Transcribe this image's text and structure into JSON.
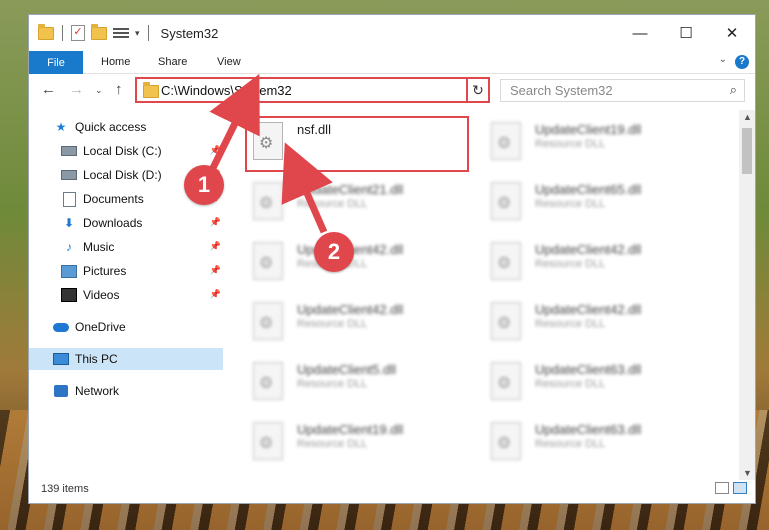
{
  "window": {
    "title": "System32",
    "controls": {
      "minimize": "—",
      "maximize": "☐",
      "close": "✕"
    }
  },
  "ribbon": {
    "file": "File",
    "tabs": [
      "Home",
      "Share",
      "View"
    ],
    "help": "?"
  },
  "address": {
    "path": "C:\\Windows\\System32",
    "search_placeholder": "Search System32"
  },
  "nav": {
    "items": [
      {
        "label": "Quick access"
      },
      {
        "label": "Local Disk (C:)"
      },
      {
        "label": "Local Disk (D:)"
      },
      {
        "label": "Documents"
      },
      {
        "label": "Downloads"
      },
      {
        "label": "Music"
      },
      {
        "label": "Pictures"
      },
      {
        "label": "Videos"
      },
      {
        "label": "OneDrive"
      },
      {
        "label": "This PC"
      },
      {
        "label": "Network"
      }
    ]
  },
  "files": {
    "left": [
      {
        "name": "nsf.dll",
        "type": ""
      },
      {
        "name": "UpdateClient21.dll",
        "type": "Resource DLL"
      },
      {
        "name": "UpdateClient42.dll",
        "type": "Resource DLL"
      },
      {
        "name": "UpdateClient42.dll",
        "type": "Resource DLL"
      },
      {
        "name": "UpdateClient5.dll",
        "type": "Resource DLL"
      },
      {
        "name": "UpdateClient19.dll",
        "type": "Resource DLL"
      }
    ],
    "right": [
      {
        "name": "UpdateClient19.dll",
        "type": "Resource DLL"
      },
      {
        "name": "UpdateClient65.dll",
        "type": "Resource DLL"
      },
      {
        "name": "UpdateClient42.dll",
        "type": "Resource DLL"
      },
      {
        "name": "UpdateClient42.dll",
        "type": "Resource DLL"
      },
      {
        "name": "UpdateClient63.dll",
        "type": "Resource DLL"
      },
      {
        "name": "UpdateClient63.dll",
        "type": "Resource DLL"
      }
    ]
  },
  "status": {
    "count": "139 items"
  },
  "markers": {
    "one": "1",
    "two": "2"
  },
  "colors": {
    "accent": "#1979ca",
    "highlight": "#e0474c",
    "selected": "#cce4f7"
  }
}
